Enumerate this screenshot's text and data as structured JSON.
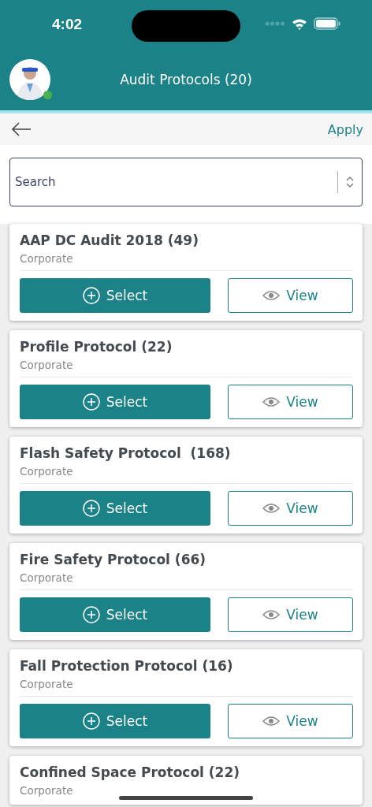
{
  "status_bar": {
    "time": "4:02"
  },
  "header": {
    "title": "Audit Protocols (20)",
    "avatar": {
      "online": true
    }
  },
  "nav": {
    "action": "Apply"
  },
  "search": {
    "placeholder": "Search"
  },
  "protocols": [
    {
      "title": "AAP DC Audit 2018 (49)",
      "subtitle": "Corporate",
      "select": "Select",
      "view": "View"
    },
    {
      "title": "Profile Protocol (22)",
      "subtitle": "Corporate",
      "select": "Select",
      "view": "View"
    },
    {
      "title": "Flash Safety Protocol  (168)",
      "subtitle": "Corporate",
      "select": "Select",
      "view": "View"
    },
    {
      "title": "Fire Safety Protocol (66)",
      "subtitle": "Corporate",
      "select": "Select",
      "view": "View"
    },
    {
      "title": "Fall Protection Protocol (16)",
      "subtitle": "Corporate",
      "select": "Select",
      "view": "View"
    },
    {
      "title": "Confined Space Protocol (22)",
      "subtitle": "Corporate"
    }
  ]
}
